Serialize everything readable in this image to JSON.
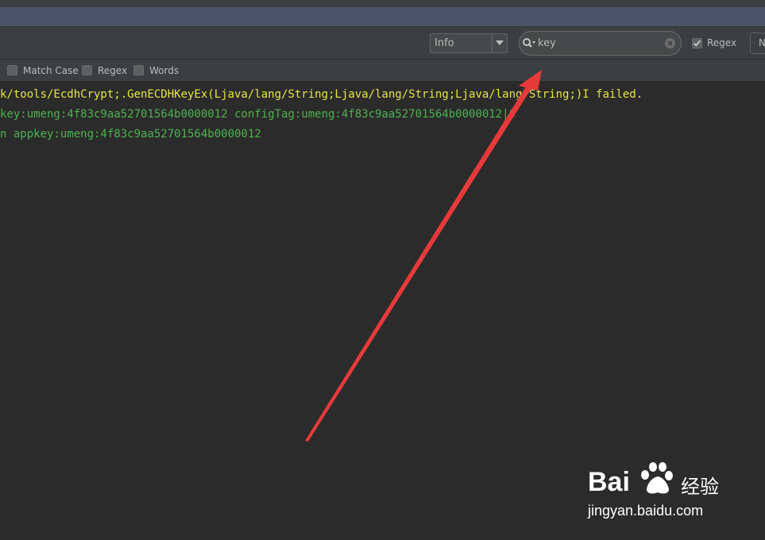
{
  "toolbar": {
    "level_select": {
      "value": "Info"
    },
    "search": {
      "value": "key"
    },
    "regex": {
      "label": "Regex",
      "checked": true
    },
    "next_button": {
      "label": "N"
    }
  },
  "search_options": {
    "match_case": {
      "label": "Match Case",
      "checked": false
    },
    "regex": {
      "label": "Regex",
      "checked": false
    },
    "words": {
      "label": "Words",
      "checked": false
    }
  },
  "log": {
    "lines": [
      {
        "text": "k/tools/EcdhCrypt;.GenECDHKeyEx(Ljava/lang/String;Ljava/lang/String;Ljava/lang/String;)I failed.",
        "color": "#e5e544"
      },
      {
        "text": "key:umeng:4f83c9aa52701564b0000012 configTag:umeng:4f83c9aa52701564b0000012|0",
        "color": "#4eb24e"
      },
      {
        "text": "n appkey:umeng:4f83c9aa52701564b0000012",
        "color": "#4eb24e"
      }
    ]
  },
  "colors": {
    "annotation_arrow": "#e83a3a",
    "background": "#2b2b2b",
    "toolbar": "#3c3f41",
    "titlebar": "#4b5367"
  },
  "watermark": {
    "brand_left": "Bai",
    "brand_right": "经验",
    "url": "jingyan.baidu.com"
  }
}
